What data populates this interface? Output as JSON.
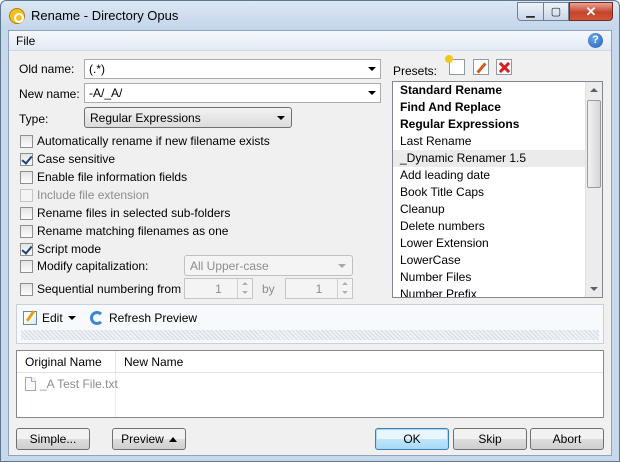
{
  "window": {
    "title": "Rename - Directory Opus",
    "minimize_glyph": "▁",
    "maximize_glyph": "▢",
    "close_glyph": "✕"
  },
  "menu": {
    "file": "File",
    "help_glyph": "?"
  },
  "fields": {
    "old_name_label": "Old name:",
    "old_name_value": "(.*)",
    "new_name_label": "New name:",
    "new_name_value": "-A/_A/",
    "type_label": "Type:",
    "type_value": "Regular Expressions"
  },
  "options": [
    {
      "label": "Automatically rename if new filename exists",
      "checked": false,
      "disabled": false
    },
    {
      "label": "Case sensitive",
      "checked": true,
      "disabled": false
    },
    {
      "label": "Enable file information fields",
      "checked": false,
      "disabled": false
    },
    {
      "label": "Include file extension",
      "checked": false,
      "disabled": true
    },
    {
      "label": "Rename files in selected sub-folders",
      "checked": false,
      "disabled": false
    },
    {
      "label": "Rename matching filenames as one",
      "checked": false,
      "disabled": false
    },
    {
      "label": "Script mode",
      "checked": true,
      "disabled": false
    },
    {
      "label": "Modify capitalization:",
      "checked": false,
      "disabled": false
    },
    {
      "label": "Sequential numbering from",
      "checked": false,
      "disabled": false
    }
  ],
  "capitalization": {
    "value": "All Upper-case"
  },
  "numbering": {
    "from": "1",
    "by_label": "by",
    "by": "1"
  },
  "presets": {
    "label": "Presets:",
    "items": [
      {
        "label": "Standard Rename",
        "bold": true
      },
      {
        "label": "Find And Replace",
        "bold": true
      },
      {
        "label": "Regular Expressions",
        "bold": true
      },
      {
        "label": "Last Rename",
        "bold": false
      },
      {
        "label": "_Dynamic Renamer 1.5",
        "bold": false,
        "highlighted": true
      },
      {
        "label": "Add leading date",
        "bold": false
      },
      {
        "label": "Book Title Caps",
        "bold": false
      },
      {
        "label": "Cleanup",
        "bold": false
      },
      {
        "label": "Delete numbers",
        "bold": false
      },
      {
        "label": "Lower Extension",
        "bold": false
      },
      {
        "label": "LowerCase",
        "bold": false
      },
      {
        "label": "Number Files",
        "bold": false
      },
      {
        "label": "Number Prefix",
        "bold": false
      }
    ]
  },
  "toolbar": {
    "edit_label": "Edit",
    "refresh_label": "Refresh Preview"
  },
  "preview": {
    "columns": [
      "Original Name",
      "New Name"
    ],
    "rows": [
      {
        "original": "_A Test File.txt",
        "new": ""
      }
    ]
  },
  "buttons": {
    "simple": "Simple...",
    "preview": "Preview",
    "ok": "OK",
    "skip": "Skip",
    "abort": "Abort"
  }
}
